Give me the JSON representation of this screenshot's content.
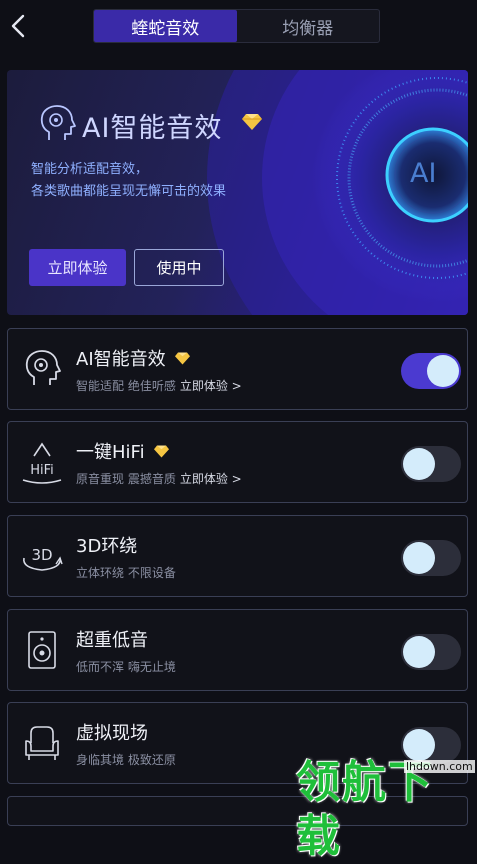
{
  "header": {
    "tabs": [
      {
        "label": "蝰蛇音效",
        "active": true
      },
      {
        "label": "均衡器",
        "active": false
      }
    ]
  },
  "banner": {
    "title": "AI智能音效",
    "desc_line1": "智能分析适配音效，",
    "desc_line2": "各类歌曲都能呈现无懈可击的效果",
    "try_label": "立即体验",
    "inuse_label": "使用中",
    "orb_label": "AI"
  },
  "effects": [
    {
      "title": "AI智能音效",
      "premium": true,
      "subtitle": "智能适配 绝佳听感",
      "link": "立即体验 >",
      "on": true,
      "icon": "ai-head-icon"
    },
    {
      "title": "一键HiFi",
      "premium": true,
      "subtitle": "原音重现 震撼音质",
      "link": "立即体验 >",
      "on": false,
      "icon": "hifi-icon"
    },
    {
      "title": "3D环绕",
      "premium": false,
      "subtitle": "立体环绕 不限设备",
      "link": "",
      "on": false,
      "icon": "3d-surround-icon"
    },
    {
      "title": "超重低音",
      "premium": false,
      "subtitle": "低而不浑 嗨无止境",
      "link": "",
      "on": false,
      "icon": "speaker-icon"
    },
    {
      "title": "虚拟现场",
      "premium": false,
      "subtitle": "身临其境 极致还原",
      "link": "",
      "on": false,
      "icon": "armchair-icon"
    }
  ],
  "watermark": {
    "text": "领航下载",
    "url": "lhdown.com"
  },
  "colors": {
    "accent": "#4b3ad0",
    "background": "#0e0f16",
    "card_border": "#3a3f55",
    "toggle_knob": "#d4ecfb",
    "premium": "#f5c542"
  }
}
